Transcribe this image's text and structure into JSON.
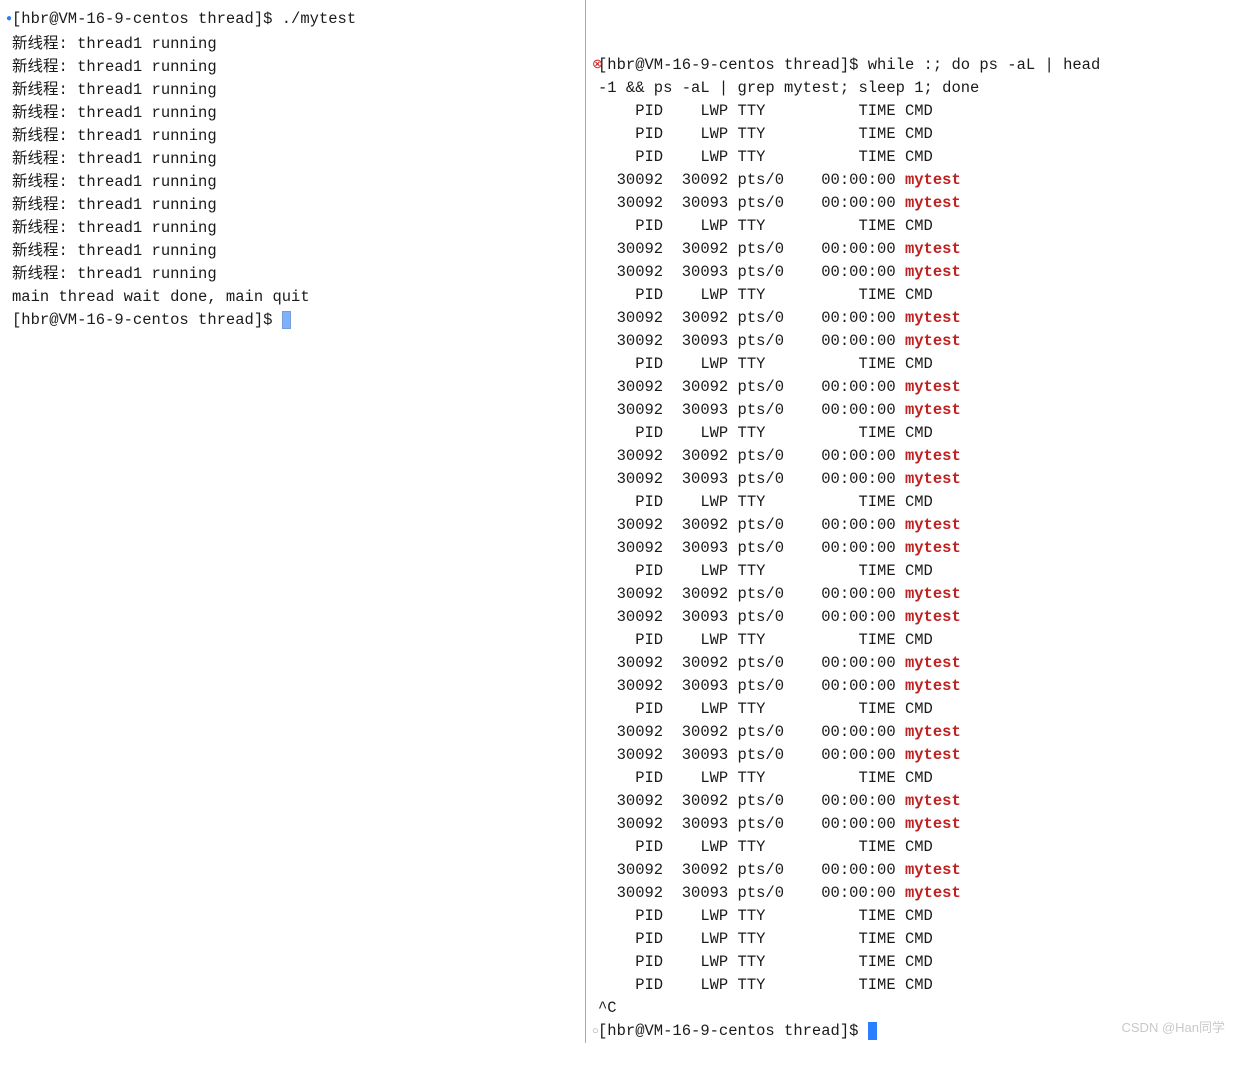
{
  "left": {
    "prompt": "[hbr@VM-16-9-centos thread]$ ",
    "cmd": "./mytest",
    "thread_prefix": "新线程: ",
    "thread_msg": "thread1 running",
    "thread_count": 11,
    "done_msg": "main thread wait done, main quit"
  },
  "right": {
    "prompt": "[hbr@VM-16-9-centos thread]$ ",
    "cmd_line1": "while :; do ps -aL | head",
    "cmd_line2": "-1 && ps -aL | grep mytest; sleep 1; done",
    "header_line": "    PID    LWP TTY          TIME CMD",
    "proc1": "  30092  30092 pts/0    00:00:00 ",
    "proc2": "  30092  30093 pts/0    00:00:00 ",
    "proc_name": "mytest",
    "pre_headers": 3,
    "both_cycles": 11,
    "post_headers": 4,
    "interrupt": "^C"
  },
  "watermark": "CSDN @Han同学"
}
